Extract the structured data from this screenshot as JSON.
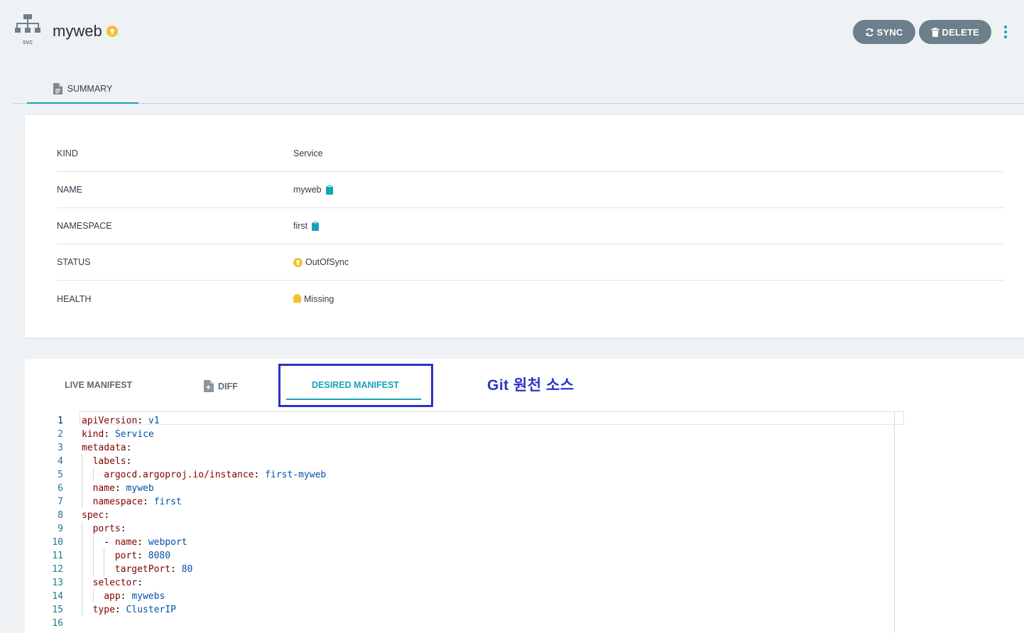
{
  "header": {
    "kind_label": "svc",
    "title": "myweb",
    "sync_button": "SYNC",
    "delete_button": "DELETE"
  },
  "top_tabs": [
    {
      "label": "SUMMARY",
      "active": true
    }
  ],
  "summary": {
    "rows": [
      {
        "label": "KIND",
        "value": "Service"
      },
      {
        "label": "NAME",
        "value": "myweb"
      },
      {
        "label": "NAMESPACE",
        "value": "first"
      },
      {
        "label": "STATUS",
        "value": "OutOfSync"
      },
      {
        "label": "HEALTH",
        "value": "Missing"
      }
    ]
  },
  "manifest_tabs": [
    {
      "label": "LIVE MANIFEST",
      "active": false
    },
    {
      "label": "DIFF",
      "active": false
    },
    {
      "label": "DESIRED MANIFEST",
      "active": true
    }
  ],
  "annotation": "Git 원천 소스",
  "editor": {
    "line_numbers": [
      "1",
      "2",
      "3",
      "4",
      "5",
      "6",
      "7",
      "8",
      "9",
      "10",
      "11",
      "12",
      "13",
      "14",
      "15",
      "16"
    ],
    "lines": [
      {
        "indent": 0,
        "key": "apiVersion",
        "value": "v1"
      },
      {
        "indent": 0,
        "key": "kind",
        "value": "Service"
      },
      {
        "indent": 0,
        "key": "metadata",
        "value": ""
      },
      {
        "indent": 1,
        "key": "labels",
        "value": ""
      },
      {
        "indent": 2,
        "key": "argocd.argoproj.io/instance",
        "value": "first-myweb"
      },
      {
        "indent": 1,
        "key": "name",
        "value": "myweb"
      },
      {
        "indent": 1,
        "key": "namespace",
        "value": "first"
      },
      {
        "indent": 0,
        "key": "spec",
        "value": ""
      },
      {
        "indent": 1,
        "key": "ports",
        "value": ""
      },
      {
        "indent": 2,
        "key": "- name",
        "value": "webport"
      },
      {
        "indent": 3,
        "key": "port",
        "value": "8080"
      },
      {
        "indent": 3,
        "key": "targetPort",
        "value": "80"
      },
      {
        "indent": 1,
        "key": "selector",
        "value": ""
      },
      {
        "indent": 2,
        "key": "app",
        "value": "mywebs"
      },
      {
        "indent": 1,
        "key": "type",
        "value": "ClusterIP"
      },
      {
        "indent": 0,
        "key": "",
        "value": ""
      }
    ]
  },
  "colors": {
    "accent": "#18a2b8",
    "out_of_sync": "#f4c030",
    "button_bg": "#6d7f8b",
    "highlight_box": "#2c32c2"
  }
}
